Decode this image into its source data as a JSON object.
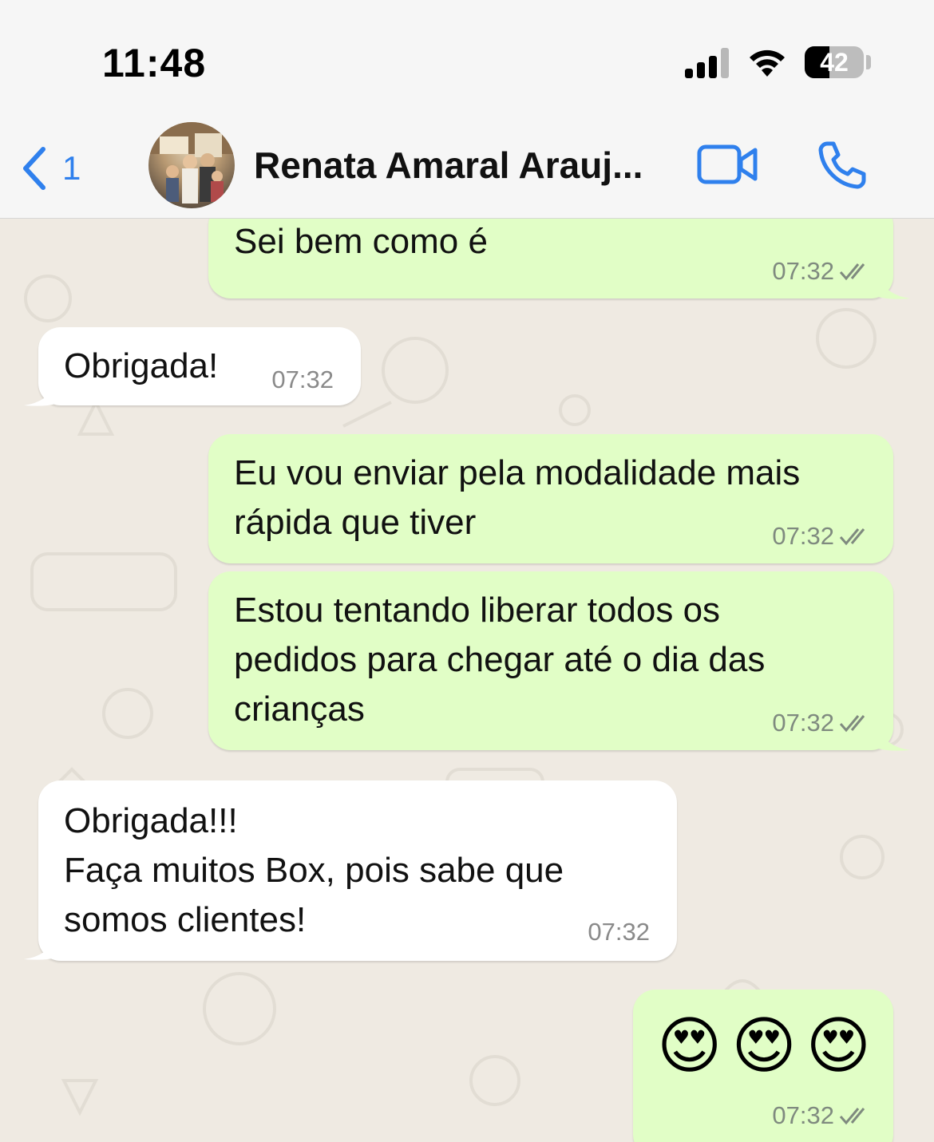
{
  "status_bar": {
    "time": "11:48",
    "battery": "42",
    "battery_level": 0.42
  },
  "header": {
    "back_count": "1",
    "contact_name": "Renata Amaral Arauj..."
  },
  "colors": {
    "accent": "#2f80ed",
    "outgoing_bubble": "#e1fec6",
    "incoming_bubble": "#ffffff",
    "chat_background": "#efeae2"
  },
  "messages": [
    {
      "direction": "outgoing",
      "text": "Sei bem como é",
      "time": "07:32",
      "status": "read"
    },
    {
      "direction": "incoming",
      "text": "Obrigada!",
      "time": "07:32"
    },
    {
      "direction": "outgoing",
      "text": "Eu vou enviar pela modalidade mais\nrápida que tiver",
      "time": "07:32",
      "status": "read"
    },
    {
      "direction": "outgoing",
      "text": "Estou tentando liberar todos os\npedidos para chegar até o dia das\ncrianças",
      "time": "07:32",
      "status": "read"
    },
    {
      "direction": "incoming",
      "text": "Obrigada!!!\nFaça muitos Box, pois sabe que\nsomos clientes!",
      "time": "07:32"
    },
    {
      "direction": "outgoing",
      "text": "😍😍😍",
      "time": "07:32",
      "status": "read"
    }
  ]
}
